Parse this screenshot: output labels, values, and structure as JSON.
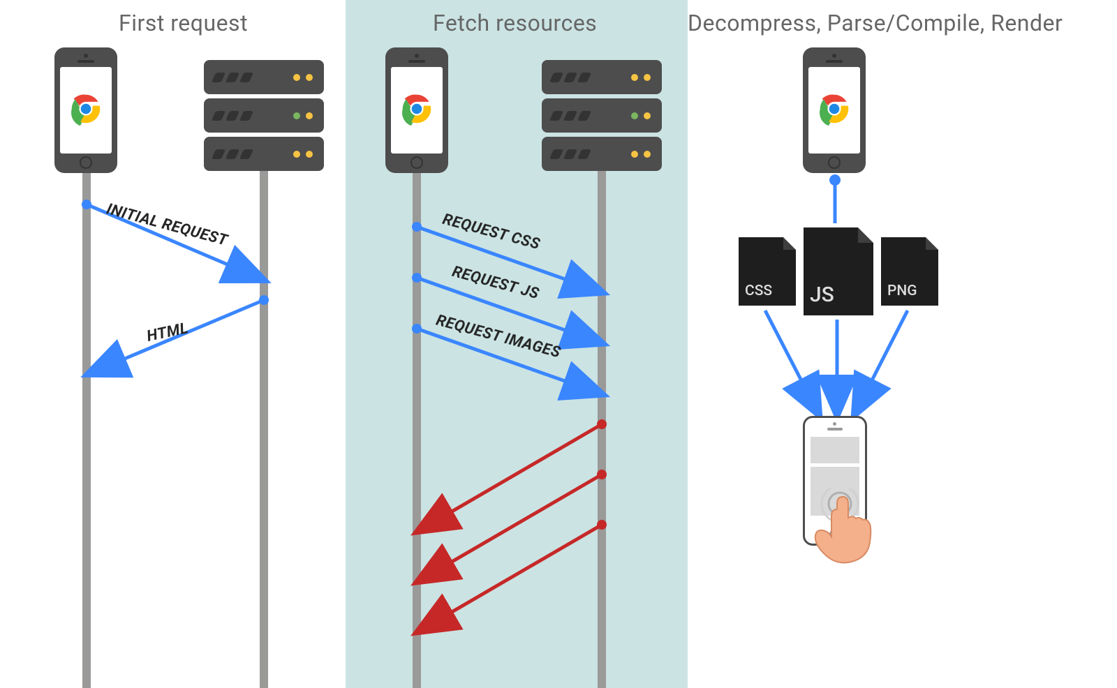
{
  "titles": {
    "p1": "First request",
    "p2": "Fetch resources",
    "p3": "Decompress, Parse/Compile, Render"
  },
  "arrows": {
    "initial": "INITIAL REQUEST",
    "html": "HTML",
    "css": "REQUEST CSS",
    "js": "REQUEST JS",
    "img": "REQUEST IMAGES"
  },
  "files": {
    "css": "CSS",
    "js": "JS",
    "png": "PNG"
  },
  "colors": {
    "request": "#3a86ff",
    "response": "#c62828",
    "lifeline": "#9a9a99",
    "panel": "#cbe3e3",
    "device": "#4d4d4d",
    "file": "#1e1e1e"
  },
  "server_leds": [
    [
      "yellow",
      "yellow"
    ],
    [
      "green",
      "yellow"
    ],
    [
      "yellow",
      "yellow"
    ]
  ]
}
